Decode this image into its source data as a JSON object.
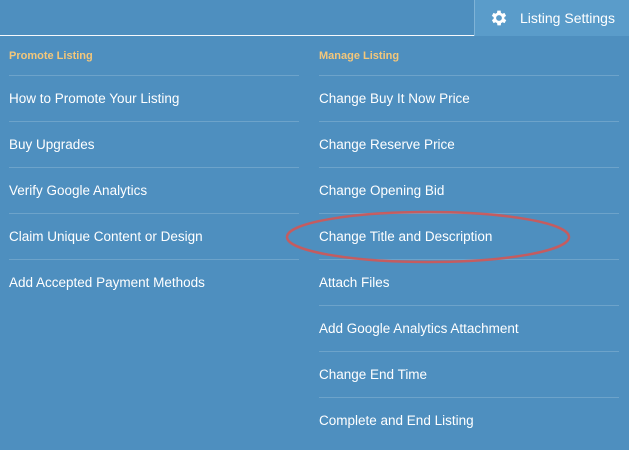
{
  "header": {
    "settings_label": "Listing Settings",
    "settings_icon": "gear-icon"
  },
  "promote": {
    "heading": "Promote Listing",
    "items": [
      "How to Promote Your Listing",
      "Buy Upgrades",
      "Verify Google Analytics",
      "Claim Unique Content or Design",
      "Add Accepted Payment Methods"
    ]
  },
  "manage": {
    "heading": "Manage Listing",
    "items": [
      "Change Buy It Now Price",
      "Change Reserve Price",
      "Change Opening Bid",
      "Change Title and Description",
      "Attach Files",
      "Add Google Analytics Attachment",
      "Change End Time",
      "Complete and End Listing"
    ]
  },
  "colors": {
    "background": "#4e8fbf",
    "heading": "#f4c77a",
    "annotation": "#d9534f"
  }
}
